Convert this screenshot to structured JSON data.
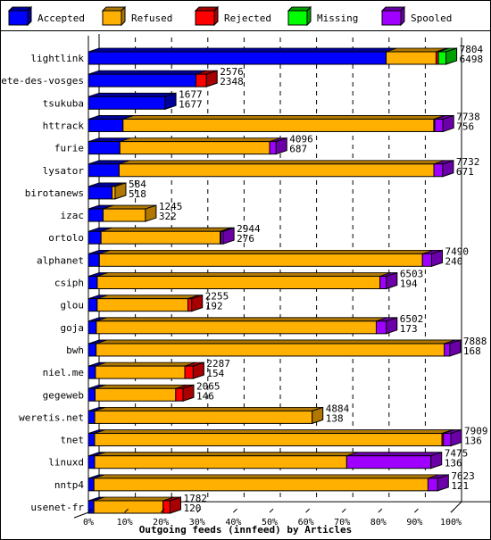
{
  "chart_data": {
    "type": "bar",
    "orientation": "horizontal",
    "stacked": true,
    "three_d": true,
    "title": "Outgoing feeds (innfeed) by Articles",
    "xlabel": "Outgoing feeds (innfeed) by Articles",
    "ylabel": "",
    "xlim": [
      0,
      100
    ],
    "x_unit": "% of largest total",
    "x_ticks": [
      "0%",
      "10%",
      "20%",
      "30%",
      "40%",
      "50%",
      "60%",
      "70%",
      "80%",
      "90%",
      "100%"
    ],
    "legend_position": "top",
    "legend": [
      {
        "name": "Accepted",
        "color": "#0000ff",
        "side": "#00009c"
      },
      {
        "name": "Refused",
        "color": "#ffb000",
        "side": "#b07800"
      },
      {
        "name": "Rejected",
        "color": "#ff0000",
        "side": "#a80000"
      },
      {
        "name": "Missing",
        "color": "#00ff00",
        "side": "#00a000"
      },
      {
        "name": "Spooled",
        "color": "#a000ff",
        "side": "#6c00a8"
      }
    ],
    "categories": [
      "lightlink",
      "bete-des-vosges",
      "tsukuba",
      "httrack",
      "furie",
      "lysator",
      "birotanews",
      "izac",
      "ortolo",
      "alphanet",
      "csiph",
      "glou",
      "goja",
      "bwh",
      "niel.me",
      "gegeweb",
      "weretis.net",
      "tnet",
      "linuxd",
      "nntp4",
      "usenet-fr"
    ],
    "totals": [
      7804,
      2576,
      1677,
      7738,
      4096,
      7732,
      584,
      1245,
      2944,
      7490,
      6503,
      2255,
      6502,
      7888,
      2287,
      2065,
      4884,
      7909,
      7475,
      7623,
      1782
    ],
    "accepted": [
      6498,
      2348,
      1677,
      756,
      687,
      671,
      518,
      322,
      276,
      240,
      194,
      192,
      173,
      168,
      154,
      146,
      138,
      136,
      136,
      121,
      120
    ],
    "series": [
      {
        "name": "Accepted",
        "values": [
          6498,
          2348,
          1677,
          756,
          687,
          671,
          518,
          322,
          276,
          240,
          194,
          192,
          173,
          168,
          154,
          146,
          138,
          136,
          136,
          121,
          120
        ]
      },
      {
        "name": "Refused",
        "values": [
          1089,
          0,
          0,
          6782,
          3269,
          6868,
          66,
          923,
          2600,
          7050,
          6169,
          1980,
          6109,
          7600,
          1950,
          1760,
          4746,
          7580,
          5500,
          7290,
          1510
        ]
      },
      {
        "name": "Rejected",
        "values": [
          50,
          228,
          0,
          20,
          0,
          0,
          0,
          0,
          20,
          0,
          0,
          83,
          0,
          0,
          183,
          159,
          0,
          30,
          0,
          0,
          152
        ]
      },
      {
        "name": "Missing",
        "values": [
          167,
          0,
          0,
          0,
          0,
          0,
          0,
          0,
          0,
          0,
          0,
          0,
          0,
          0,
          0,
          0,
          0,
          0,
          0,
          0,
          0
        ]
      },
      {
        "name": "Spooled",
        "values": [
          0,
          0,
          0,
          180,
          140,
          193,
          0,
          0,
          48,
          200,
          140,
          0,
          220,
          120,
          0,
          0,
          0,
          163,
          1839,
          212,
          0
        ]
      }
    ]
  }
}
